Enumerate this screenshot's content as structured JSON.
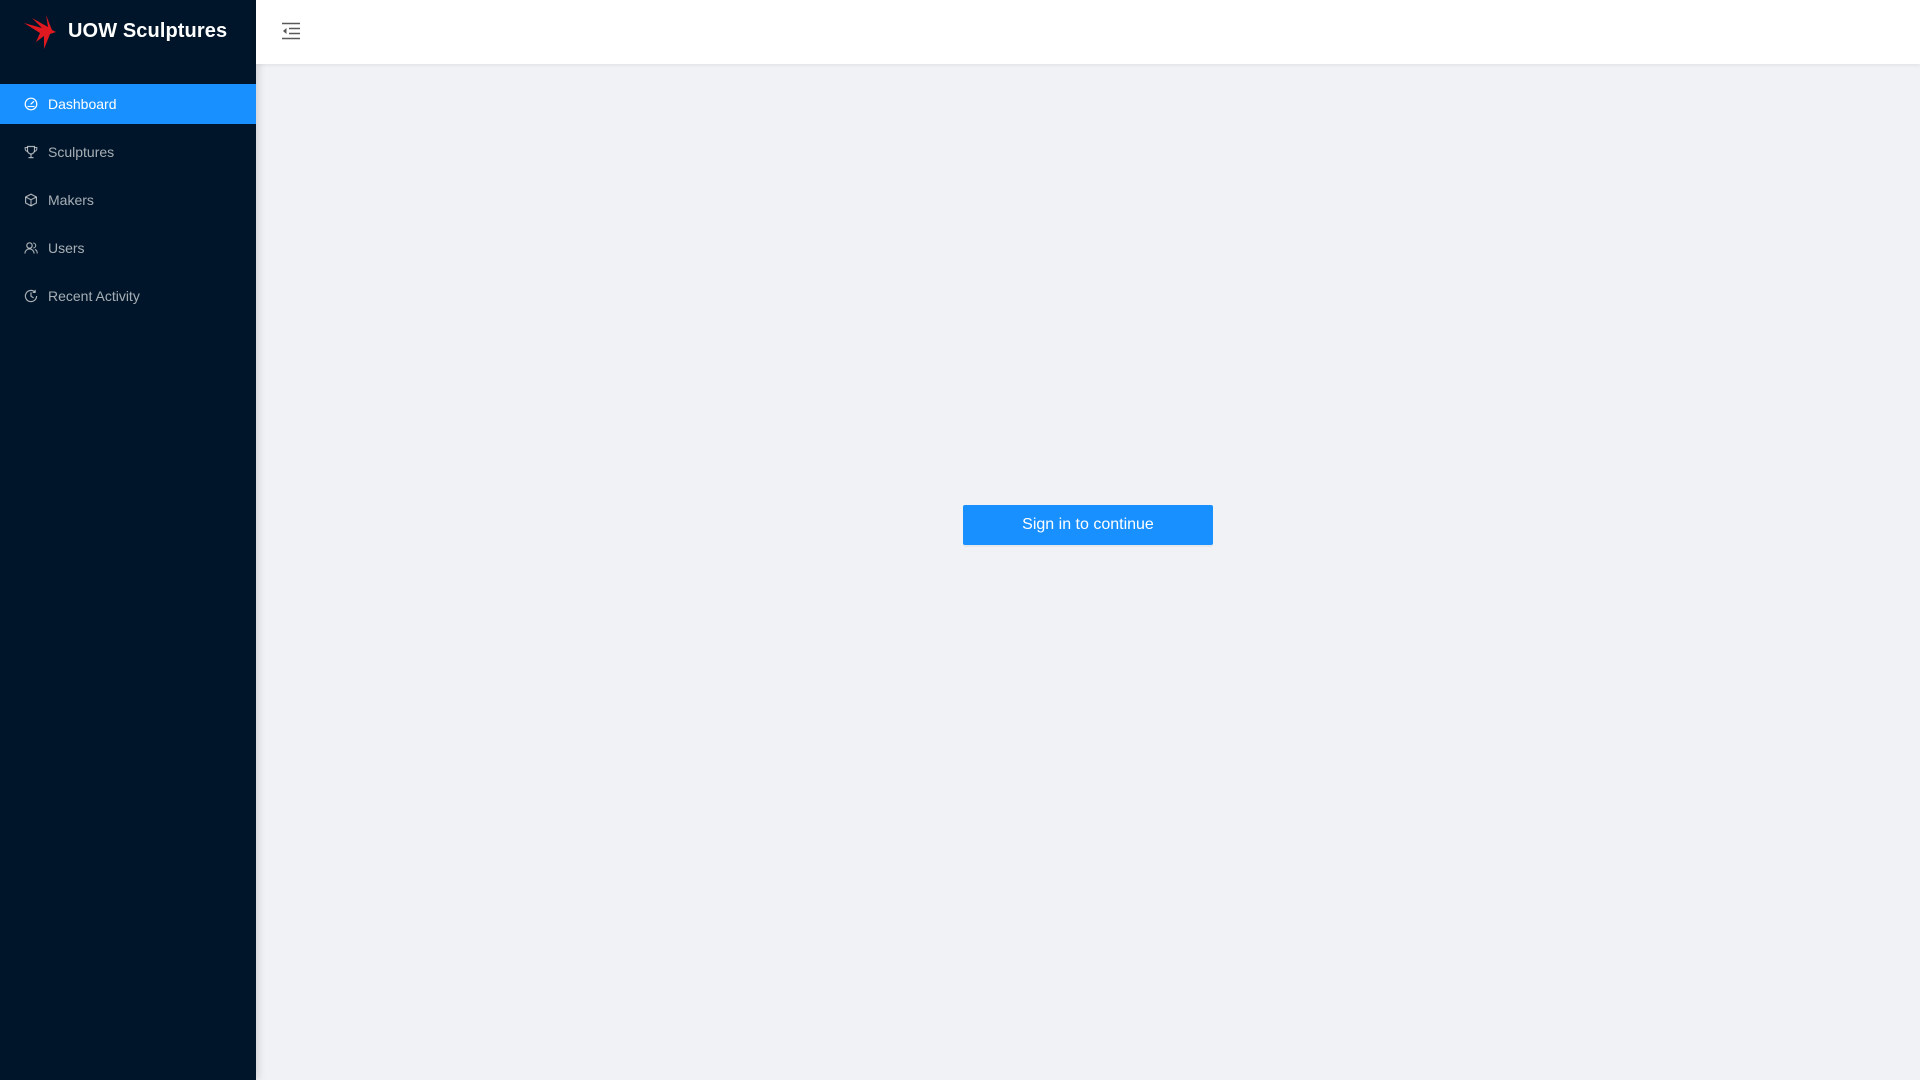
{
  "app": {
    "brand_title": "UOW Sculptures"
  },
  "sidebar": {
    "items": [
      {
        "label": "Dashboard",
        "icon": "dashboard-icon",
        "active": true
      },
      {
        "label": "Sculptures",
        "icon": "trophy-icon",
        "active": false
      },
      {
        "label": "Makers",
        "icon": "cube-icon",
        "active": false
      },
      {
        "label": "Users",
        "icon": "users-icon",
        "active": false
      },
      {
        "label": "Recent Activity",
        "icon": "history-icon",
        "active": false
      }
    ]
  },
  "header": {
    "menu_toggle_icon": "menu-fold-icon"
  },
  "main": {
    "signin_label": "Sign in to continue"
  },
  "colors": {
    "sidebar_bg": "#001529",
    "accent": "#1890ff",
    "content_bg": "#f0f2f5",
    "logo_red": "#e0181f"
  }
}
